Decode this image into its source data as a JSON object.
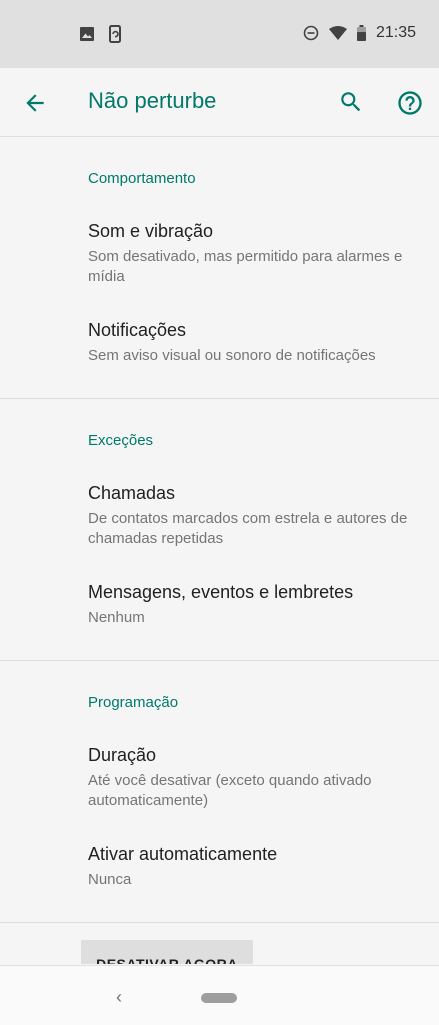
{
  "status_bar": {
    "time": "21:35",
    "icons": [
      "image-icon",
      "screen-rotate-icon",
      "dnd-icon",
      "wifi-icon",
      "battery-icon"
    ]
  },
  "app_bar": {
    "title": "Não perturbe",
    "icons": [
      "back-arrow-icon",
      "search-icon",
      "help-icon"
    ],
    "accent_color": "#00796b"
  },
  "sections": [
    {
      "header": "Comportamento",
      "items": [
        {
          "title": "Som e vibração",
          "summary": "Som desativado, mas permitido para alarmes e mídia"
        },
        {
          "title": "Notificações",
          "summary": "Sem aviso visual ou sonoro de notificações"
        }
      ]
    },
    {
      "header": "Exceções",
      "items": [
        {
          "title": "Chamadas",
          "summary": "De contatos marcados com estrela e autores de chamadas repetidas"
        },
        {
          "title": "Mensagens, eventos e lembretes",
          "summary": "Nenhum"
        }
      ]
    },
    {
      "header": "Programação",
      "items": [
        {
          "title": "Duração",
          "summary": "Até você desativar (exceto quando ativado automaticamente)"
        },
        {
          "title": "Ativar automaticamente",
          "summary": "Nunca"
        }
      ]
    }
  ],
  "bottom_button": {
    "label": "DESATIVAR AGORA"
  },
  "nav_bar": {
    "back_glyph": "‹"
  }
}
